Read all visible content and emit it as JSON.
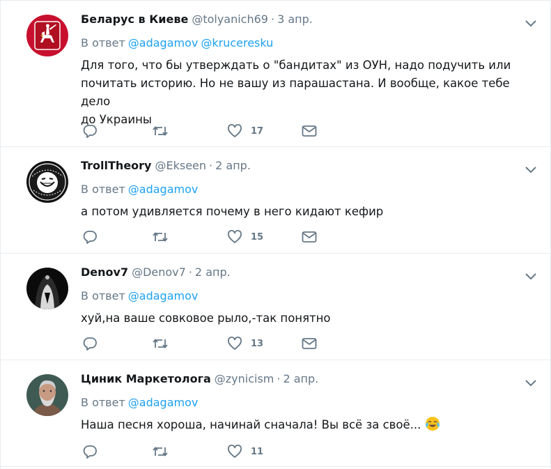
{
  "tweets": [
    {
      "fullname": "Беларус в Киеве",
      "username": "@tolyanich69",
      "time": "3 апр.",
      "reply_label": "В ответ",
      "mentions": [
        "@adagamov",
        "@kruceresku"
      ],
      "text_lines": [
        "Для того, что бы утверждать о \"бандитах\" из ОУН, надо подучить или",
        "почитать историю. Но не вашу из парашастана. И вообще, какое тебе дело",
        "до Украины"
      ],
      "likes": "17"
    },
    {
      "fullname": "TrollTheory",
      "username": "@Ekseen",
      "time": "2 апр.",
      "reply_label": "В ответ",
      "mentions": [
        "@adagamov"
      ],
      "text_lines": [
        "а потом удивляется почему в него кидают кефир"
      ],
      "likes": "15"
    },
    {
      "fullname": "Denov7",
      "username": "@Denov7",
      "time": "2 апр.",
      "reply_label": "В ответ",
      "mentions": [
        "@adagamov"
      ],
      "text_lines": [
        "хуй,на ваше совковое рыло,-так понятно"
      ],
      "likes": "13"
    },
    {
      "fullname": "Циник Маркетолога",
      "username": "@zynicism",
      "time": "2 апр.",
      "reply_label": "В ответ",
      "mentions": [
        "@adagamov"
      ],
      "text_lines": [
        "Наша песня хороша, начинай сначала! Вы всё за своё..."
      ],
      "likes": "11"
    }
  ],
  "separator": "·",
  "icons": {
    "reply": "reply-icon",
    "retweet": "retweet-icon",
    "like": "heart-icon",
    "dm": "envelope-icon",
    "caret": "chevron-down-icon",
    "emoji": "tears-of-joy-emoji"
  },
  "colors": {
    "link": "#1da1f2",
    "secondary": "#657786",
    "text": "#14171a",
    "border": "#e6ecf0"
  }
}
